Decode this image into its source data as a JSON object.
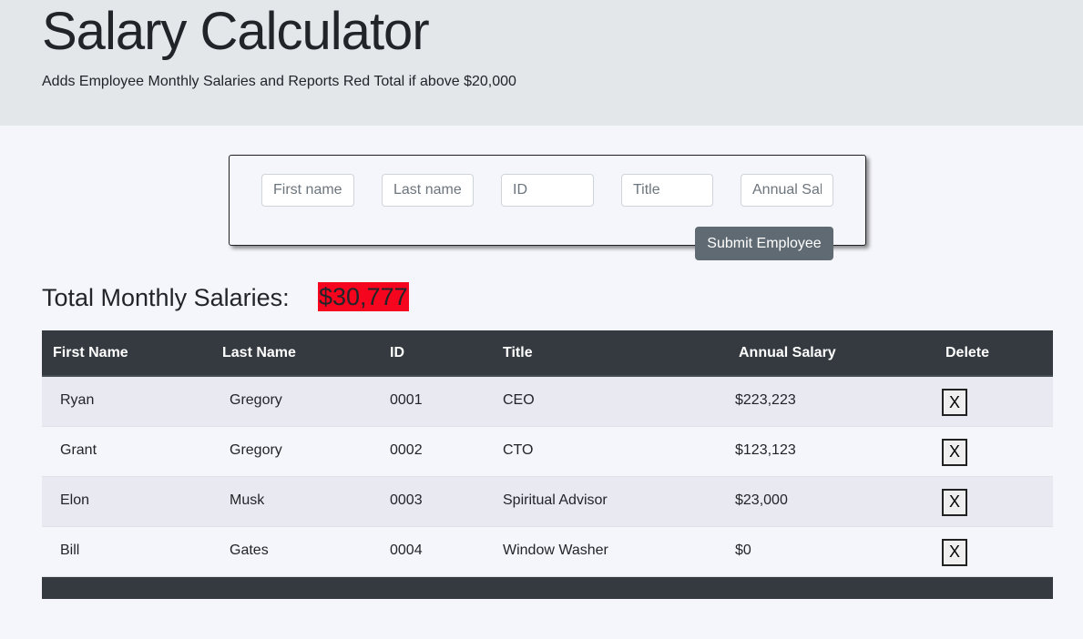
{
  "header": {
    "title": "Salary Calculator",
    "subtitle": "Adds Employee Monthly Salaries and Reports Red Total if above $20,000"
  },
  "form": {
    "first_name_placeholder": "First name",
    "last_name_placeholder": "Last name",
    "id_placeholder": "ID",
    "title_placeholder": "Title",
    "annual_salary_placeholder": "Annual Salary",
    "submit_label": "Submit Employee"
  },
  "total": {
    "label": "Total Monthly Salaries:",
    "value": "$30,777",
    "highlight_color": "#f5051e"
  },
  "table": {
    "headers": [
      "First Name",
      "Last Name",
      "ID",
      "Title",
      "Annual Salary",
      "Delete"
    ],
    "rows": [
      {
        "first": "Ryan",
        "last": "Gregory",
        "id": "0001",
        "title": "CEO",
        "salary": "$223,223",
        "delete": "X"
      },
      {
        "first": "Grant",
        "last": "Gregory",
        "id": "0002",
        "title": "CTO",
        "salary": "$123,123",
        "delete": "X"
      },
      {
        "first": "Elon",
        "last": "Musk",
        "id": "0003",
        "title": "Spiritual Advisor",
        "salary": "$23,000",
        "delete": "X"
      },
      {
        "first": "Bill",
        "last": "Gates",
        "id": "0004",
        "title": "Window Washer",
        "salary": "$0",
        "delete": "X"
      }
    ]
  },
  "colors": {
    "header_bg": "#343a40",
    "jumbotron_bg": "#e4e7ea",
    "button_bg": "#5f6a72"
  }
}
